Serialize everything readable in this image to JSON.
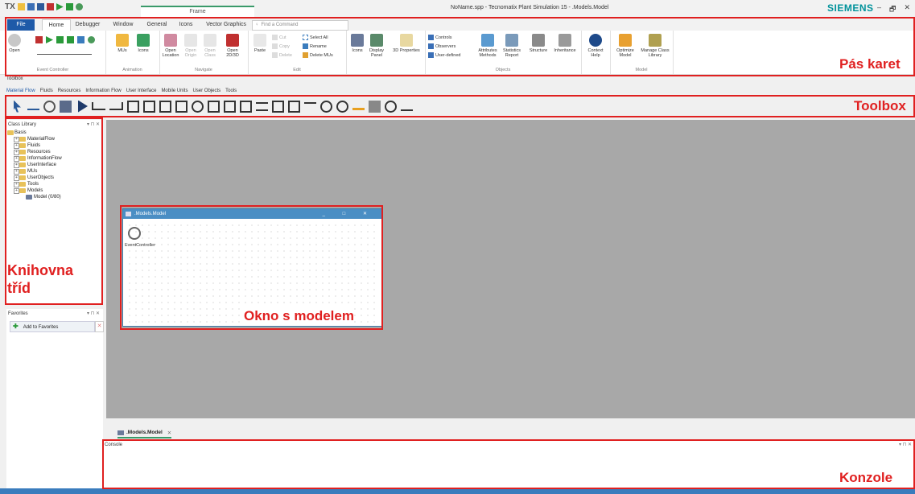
{
  "app": {
    "context_tab": "Frame",
    "window_title": "NoName.spp - Tecnomatix Plant Simulation 15 - .Models.Model",
    "brand": "SIEMENS",
    "window_controls": [
      "–",
      "🗗",
      "✕"
    ]
  },
  "ribbon": {
    "tabs": [
      "File",
      "Home",
      "Debugger",
      "Window",
      "General",
      "Icons",
      "Vector Graphics"
    ],
    "active_tab": "Home",
    "search_placeholder": "Find a Command",
    "groups": {
      "event_controller": {
        "label": "Event Controller",
        "open": "Open"
      },
      "animation": {
        "label": "Animation",
        "mus": "MUs",
        "icons": "Icons"
      },
      "navigate": {
        "label": "Navigate",
        "open_location": "Open Location",
        "open_origin": "Open Origin",
        "open_class": "Open Class",
        "open_2d3d": "Open 2D/3D"
      },
      "edit": {
        "label": "Edit",
        "paste": "Paste",
        "cut": "Cut",
        "copy": "Copy",
        "delete": "Delete",
        "select_all": "Select All",
        "rename": "Rename",
        "delete_mus": "Delete MUs"
      },
      "display": {
        "icons": "Icons",
        "display_panel": "Display Panel",
        "properties_3d": "3D Properties"
      },
      "objects": {
        "label": "Objects",
        "controls": "Controls",
        "observers": "Observers",
        "user_defined": "User-defined",
        "attributes_methods": "Attributes Methods",
        "statistics_report": "Statistics Report",
        "structure": "Structure",
        "inheritance": "Inheritance"
      },
      "help": {
        "context_help": "Context Help"
      },
      "model": {
        "label": "Model",
        "optimize_model": "Optimize Model",
        "manage_class_library": "Manage Class Library"
      }
    }
  },
  "toolbox": {
    "title": "Toolbox",
    "tabs": [
      "Material Flow",
      "Fluids",
      "Resources",
      "Information Flow",
      "User Interface",
      "Mobile Units",
      "User Objects",
      "Tools"
    ],
    "active_tab": "Material Flow"
  },
  "class_library": {
    "title": "Class Library",
    "root": "Basis",
    "items": [
      "MaterialFlow",
      "Fluids",
      "Resources",
      "InformationFlow",
      "UserInterface",
      "MUs",
      "UserObjects",
      "Tools",
      "Models"
    ],
    "model_item": "Model (0/80)"
  },
  "favorites": {
    "title": "Favorites",
    "add_button": "Add to Favorites"
  },
  "model_window": {
    "title": ".Models.Model",
    "object_label": "EventController"
  },
  "doc_tab": {
    "label": ".Models.Model"
  },
  "console": {
    "title": "Console"
  },
  "annotations": {
    "ribbon": "Pás karet",
    "toolbox": "Toolbox",
    "class_library": "Knihovna tříd",
    "model_window": "Okno s modelem",
    "console": "Konzole"
  },
  "colors": {
    "annotation": "#e02020",
    "file_tab": "#1e5aa8",
    "window_title": "#4a8ec4",
    "brand": "#00929b"
  }
}
